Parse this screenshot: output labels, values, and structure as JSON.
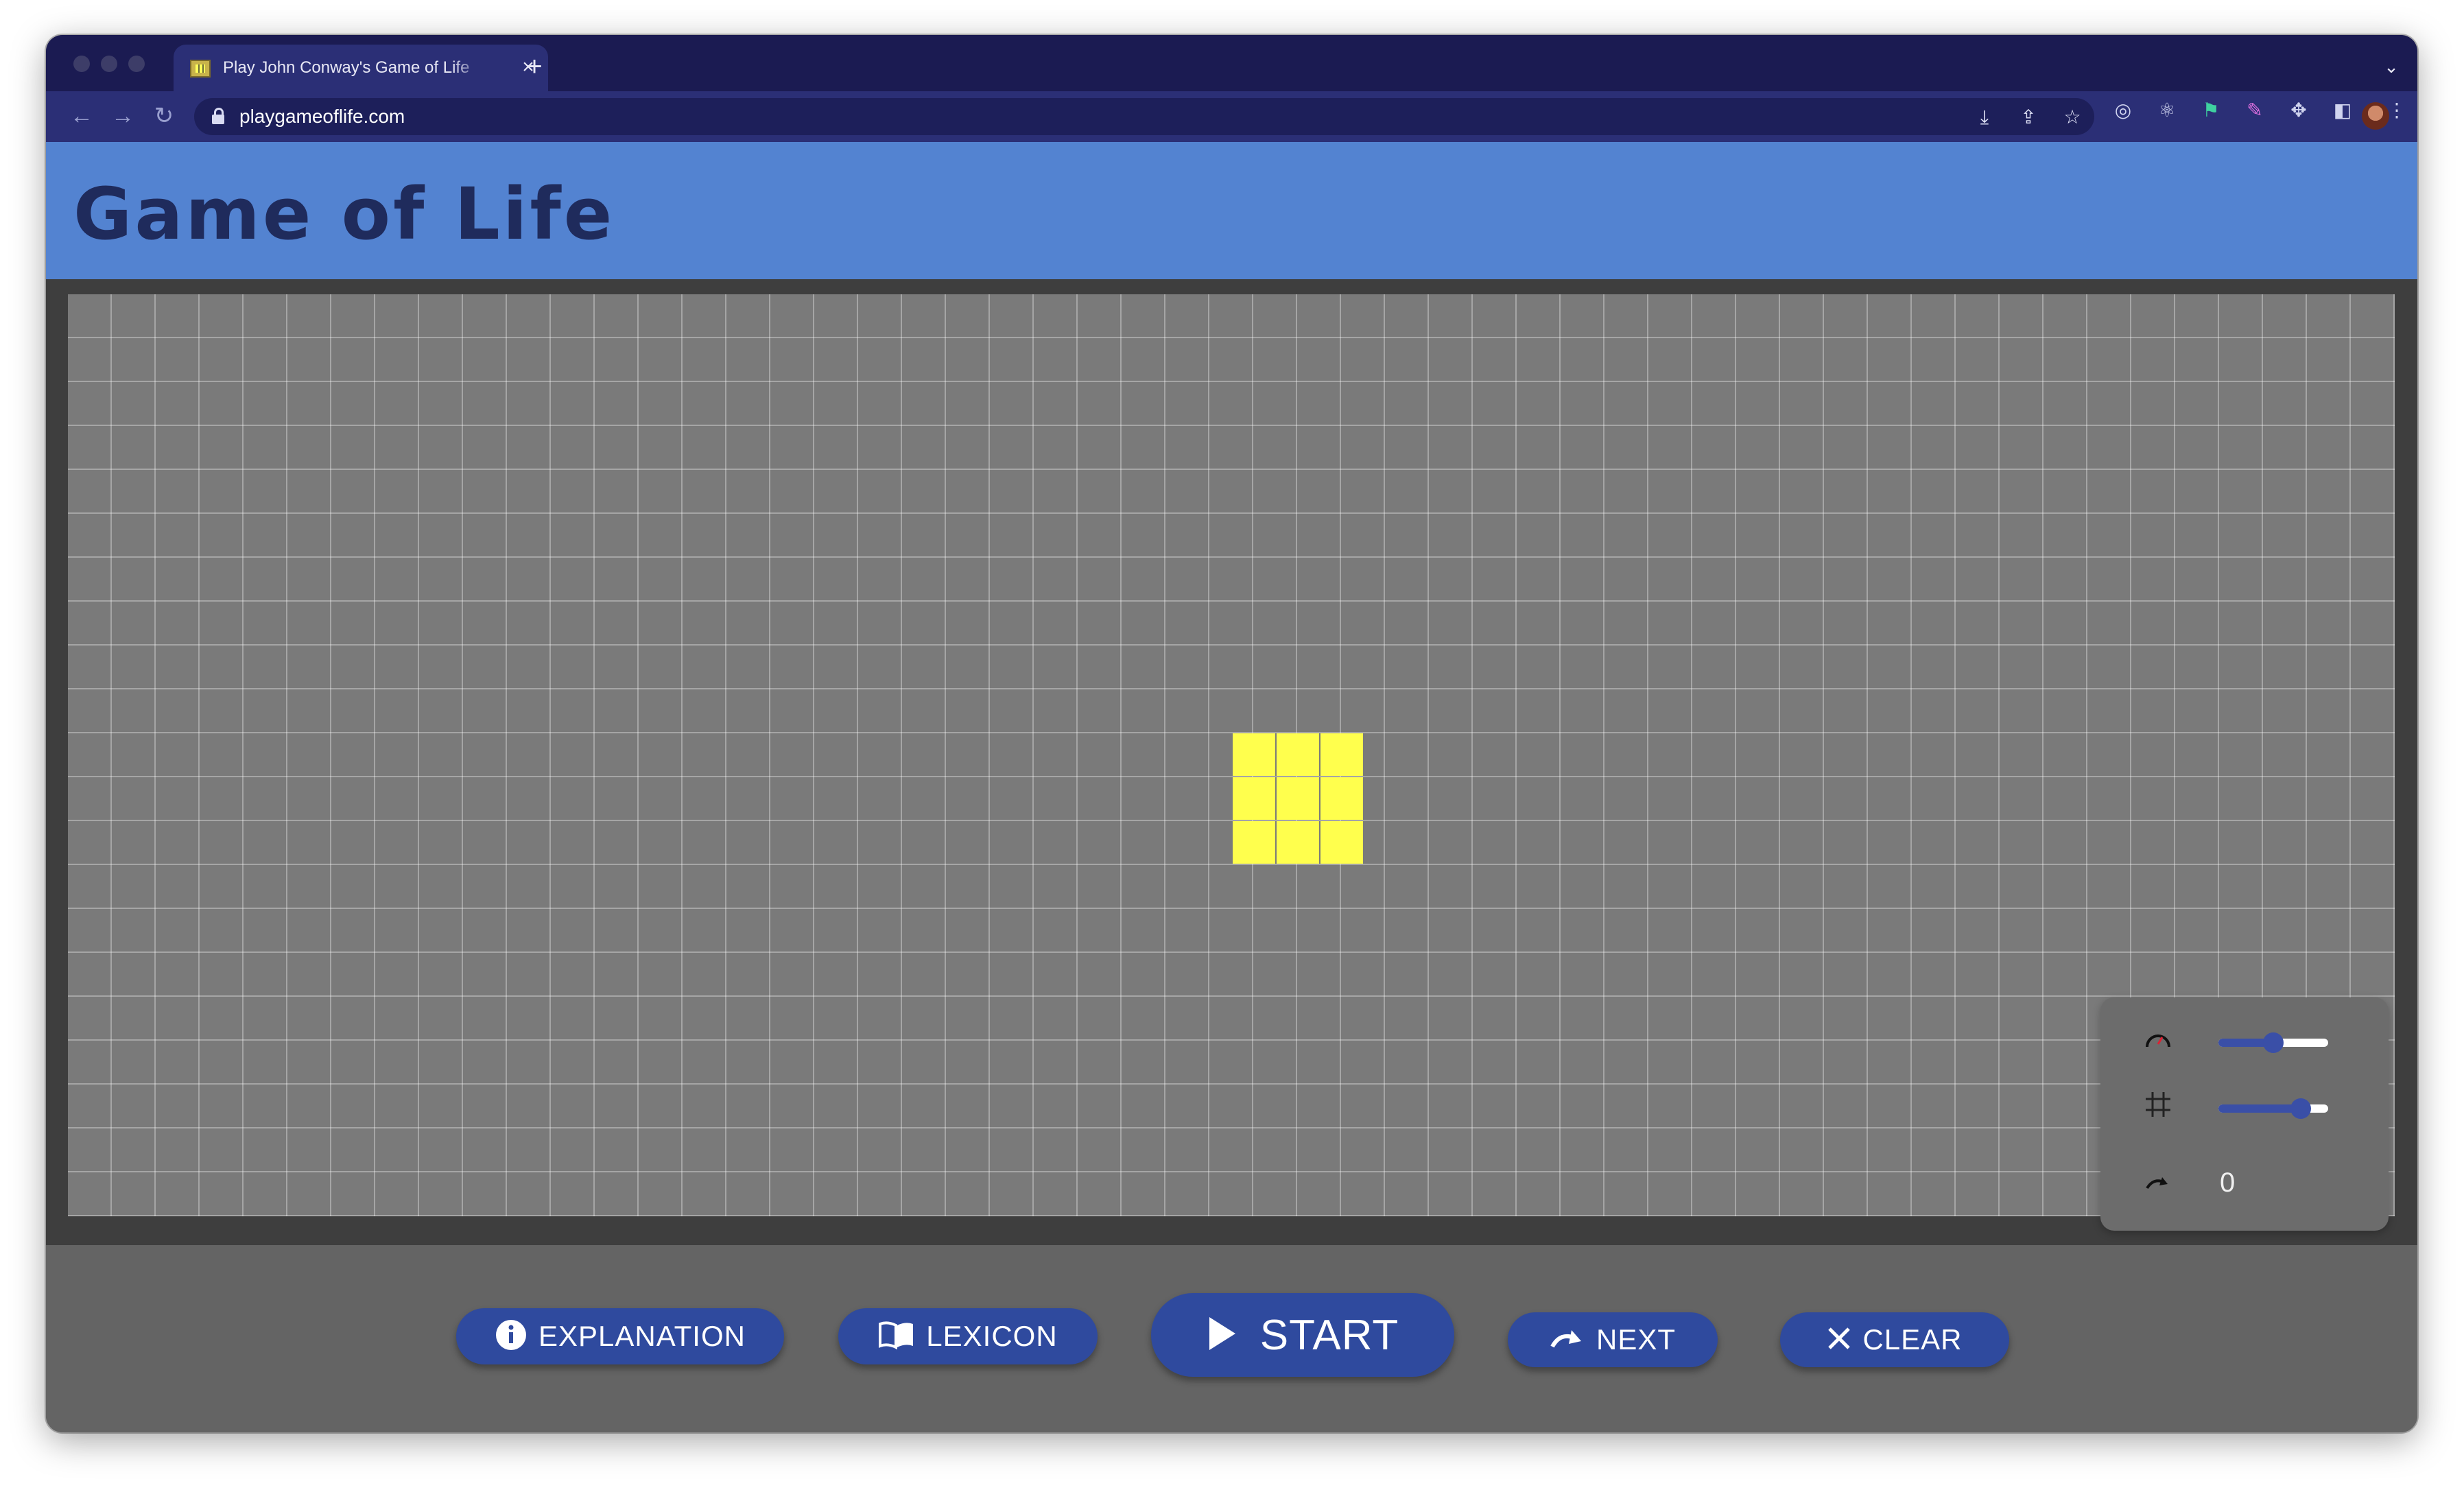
{
  "browser": {
    "tab_title": "Play John Conway's Game of Life",
    "tab_close": "×",
    "new_tab": "+",
    "tab_menu": "⌄",
    "url": "playgameoflife.com",
    "nav": {
      "back": "←",
      "forward": "→",
      "reload": "↻"
    },
    "omnibox_icons": [
      "install-icon",
      "share-icon",
      "bookmark-star-icon"
    ],
    "extension_icons": [
      "target-extension-icon",
      "react-extension-icon",
      "green-extension-icon",
      "pink-extension-icon",
      "puzzle-extensions-icon",
      "side-panel-icon"
    ],
    "menu": "⋮"
  },
  "page": {
    "title": "Game of Life",
    "colors": {
      "header": "#5383d1",
      "title": "#1f2b5c",
      "board": "#7a7a7a",
      "live_cell": "#ffff4d",
      "button": "#2f4a9e"
    }
  },
  "board": {
    "cell_size_label": "",
    "live_cells_count": 9,
    "pattern": "3x3 block"
  },
  "controls": {
    "speed_icon": "speedometer-icon",
    "speed_level": 0.5,
    "size_icon": "grid-icon",
    "size_level": 0.75,
    "generation_icon": "redo-arrow-icon",
    "generation": "0"
  },
  "buttons": {
    "explanation": "EXPLANATION",
    "lexicon": "LEXICON",
    "start": "START",
    "next": "NEXT",
    "clear": "CLEAR"
  }
}
